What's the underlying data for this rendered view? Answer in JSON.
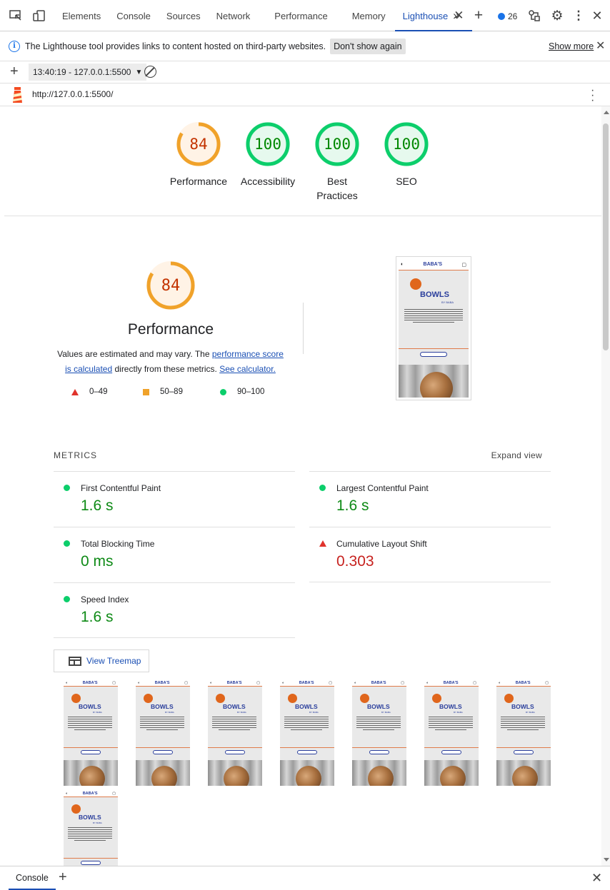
{
  "tabs": {
    "items": [
      "Elements",
      "Console",
      "Sources",
      "Network",
      "Performance",
      "Memory",
      "Lighthouse"
    ],
    "issues_count": "26"
  },
  "infobar": {
    "message": "The Lighthouse tool provides links to content hosted on third-party websites.",
    "dont_show": "Don't show again",
    "show_more": "Show more"
  },
  "toolbar": {
    "run_label": "13:40:19 - 127.0.0.1:5500"
  },
  "url": "http://127.0.0.1:5500/",
  "scores": [
    {
      "label": "Performance",
      "value": "84",
      "score": 84,
      "color": "#f0a22a",
      "text_color": "#c33300",
      "bg": "#fff3e6"
    },
    {
      "label": "Accessibility",
      "value": "100",
      "score": 100,
      "color": "#0cce6b",
      "text_color": "#008800",
      "bg": "#e6f9ee"
    },
    {
      "label": "Best Practices",
      "value": "100",
      "score": 100,
      "color": "#0cce6b",
      "text_color": "#008800",
      "bg": "#e6f9ee"
    },
    {
      "label": "SEO",
      "value": "100",
      "score": 100,
      "color": "#0cce6b",
      "text_color": "#008800",
      "bg": "#e6f9ee"
    }
  ],
  "performance": {
    "score": "84",
    "title": "Performance",
    "desc_pre": "Values are estimated and may vary. The ",
    "desc_link1": "performance score is calculated",
    "desc_mid": " directly from these metrics. ",
    "desc_link2": "See calculator.",
    "legend": [
      "0–49",
      "50–89",
      "90–100"
    ]
  },
  "screenshot": {
    "brand": "BABA'S",
    "heading": "BOWLS",
    "sub": "BY BABA",
    "button": "EDIT PRODUCTS"
  },
  "metrics": {
    "title": "METRICS",
    "expand": "Expand view",
    "items": [
      {
        "name": "First Contentful Paint",
        "value": "1.6 s",
        "status": "good"
      },
      {
        "name": "Largest Contentful Paint",
        "value": "1.6 s",
        "status": "good"
      },
      {
        "name": "Total Blocking Time",
        "value": "0 ms",
        "status": "good"
      },
      {
        "name": "Cumulative Layout Shift",
        "value": "0.303",
        "status": "poor"
      },
      {
        "name": "Speed Index",
        "value": "1.6 s",
        "status": "good"
      }
    ]
  },
  "treemap_label": "View Treemap",
  "bottom": {
    "console_tab": "Console"
  }
}
